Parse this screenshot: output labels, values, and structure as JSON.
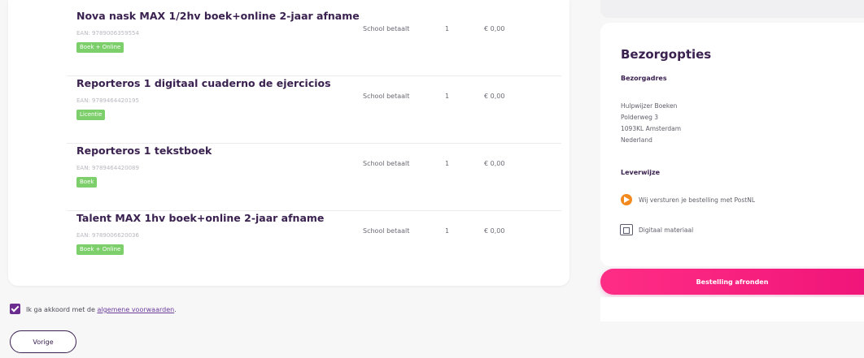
{
  "products": [
    {
      "title": "Nova nask MAX 1/2hv boek+online 2-jaar afname",
      "ean": "EAN: 9789006359554",
      "badge": "Boek + Online",
      "payer": "School betaalt",
      "qty": "1",
      "price": "€ 0,00"
    },
    {
      "title": "Reporteros 1 digitaal cuaderno de ejercicios",
      "ean": "EAN: 9789464420195",
      "badge": "Licentie",
      "payer": "School betaalt",
      "qty": "1",
      "price": "€ 0,00"
    },
    {
      "title": "Reporteros 1 tekstboek",
      "ean": "EAN: 9789464420089",
      "badge": "Boek",
      "payer": "School betaalt",
      "qty": "1",
      "price": "€ 0,00"
    },
    {
      "title": "Talent MAX 1hv boek+online 2-jaar afname",
      "ean": "EAN: 9789006620036",
      "badge": "Boek + Online",
      "payer": "School betaalt",
      "qty": "1",
      "price": "€ 0,00"
    }
  ],
  "delivery": {
    "title": "Bezorgopties",
    "address_label": "Bezorgadres",
    "address_lines": [
      "Hulpwijzer Boeken",
      "Polderweg 3",
      "1093KL Amsterdam",
      "Nederland"
    ],
    "method_label": "Leverwijze",
    "options": [
      {
        "icon": "postnl-icon",
        "text": "Wij versturen je bestelling met PostNL"
      },
      {
        "icon": "digital-material-icon",
        "text": "Digitaal materiaal"
      }
    ]
  },
  "order_button_label": "Bestelling afronden",
  "agreement": {
    "text": "Ik ga akkoord met de ",
    "link": "algemene voorwaarden",
    "suffix": "."
  },
  "back_button_label": "Vorige",
  "colors": {
    "accent": "#f0157a",
    "brand": "#6b2d8f",
    "badge": "#7ccf6a",
    "post": "#f28a1d"
  }
}
